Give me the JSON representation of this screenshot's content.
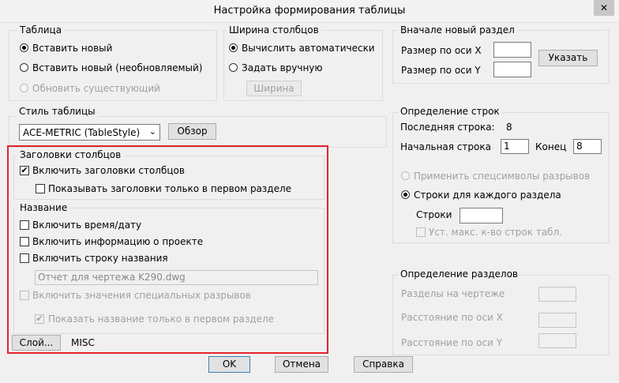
{
  "window": {
    "title": "Настройка формирования таблицы",
    "close_glyph": "✕"
  },
  "table": {
    "label": "Таблица",
    "insert_new": "Вставить новый",
    "insert_new_static": "Вставить новый (необновляемый)",
    "update_existing": "Обновить существующий"
  },
  "columns": {
    "label": "Ширина столбцов",
    "auto": "Вычислить автоматически",
    "manual": "Задать вручную",
    "width_button": "Ширина"
  },
  "new_section": {
    "label": "Вначале новый раздел",
    "size_x": "Размер по оси X",
    "size_y": "Размер по оси Y",
    "pick_button": "Указать"
  },
  "style": {
    "label": "Стиль таблицы",
    "selected": "ACE-METRIC  (TableStyle)",
    "browse_button": "Обзор"
  },
  "headers": {
    "label": "Заголовки столбцов",
    "include": "Включить заголовки столбцов",
    "first_only": "Показывать заголовки только в первом разделе"
  },
  "title_group": {
    "label": "Название",
    "datetime": "Включить время/дату",
    "project_info": "Включить информацию о проекте",
    "title_row": "Включить строку названия",
    "title_value": "Отчет для чертежа K290.dwg",
    "special_breaks": "Включить значения специальных разрывов",
    "first_section_only": "Показать название только в первом разделе"
  },
  "layer": {
    "button": "Слой...",
    "value": "MISC"
  },
  "rows": {
    "label": "Определение строк",
    "last_row_label": "Последняя строка:",
    "last_row_value": "8",
    "start_label": "Начальная строка",
    "start_value": "1",
    "end_label": "Конец",
    "end_value": "8",
    "apply_special": "Применить спецсимволы разрывов",
    "per_section": "Строки для каждого раздела",
    "rows_label": "Строки",
    "max_rows": "Уст. макс. к-во строк табл."
  },
  "sections": {
    "label": "Определение разделов",
    "on_drawing": "Разделы на чертеже",
    "dist_x": "Расстояние по оси X",
    "dist_y": "Расстояние по оси Y"
  },
  "footer": {
    "ok": "OK",
    "cancel": "Отмена",
    "help": "Справка"
  },
  "glyphs": {
    "check": "✔",
    "arrow": "⌄"
  },
  "colors": {
    "highlight": "#e3242b",
    "ok_border": "#3c7fb1"
  }
}
